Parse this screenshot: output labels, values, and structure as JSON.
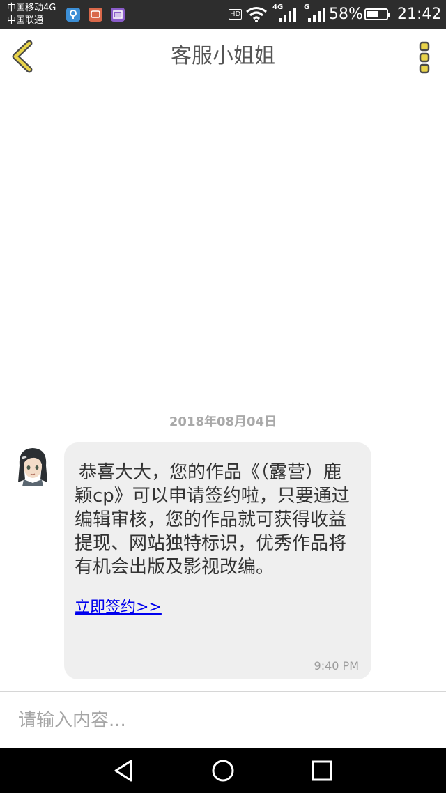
{
  "status_bar": {
    "carrier_1": "中国移动4G",
    "carrier_2": "中国联通",
    "hd_label": "HD",
    "net_1": "4G",
    "net_2": "G",
    "battery_percent": "58%",
    "battery_level": 0.58,
    "time": "21:42",
    "notification_icons": [
      "location-app-icon",
      "message-app-icon",
      "list-app-icon"
    ]
  },
  "header": {
    "title": "客服小姐姐",
    "back_icon": "chevron-left-icon",
    "menu_icon": "vertical-dots-icon",
    "accent_color": "#e8d34a"
  },
  "chat": {
    "date": "2018年08月04日",
    "messages": [
      {
        "sender": "avatar",
        "text": "恭喜大大，您的作品《（露营）鹿颖cp》可以申请签约啦，只要通过编辑审核，您的作品就可获得收益提现、网站独特标识，优秀作品将有机会出版及影视改编。",
        "link": "立即签约>>",
        "time": "9:40 PM"
      }
    ]
  },
  "input": {
    "placeholder": "请输入内容...",
    "value": ""
  },
  "nav_bar": {
    "icons": [
      "back-triangle-icon",
      "home-circle-icon",
      "recents-square-icon"
    ]
  }
}
